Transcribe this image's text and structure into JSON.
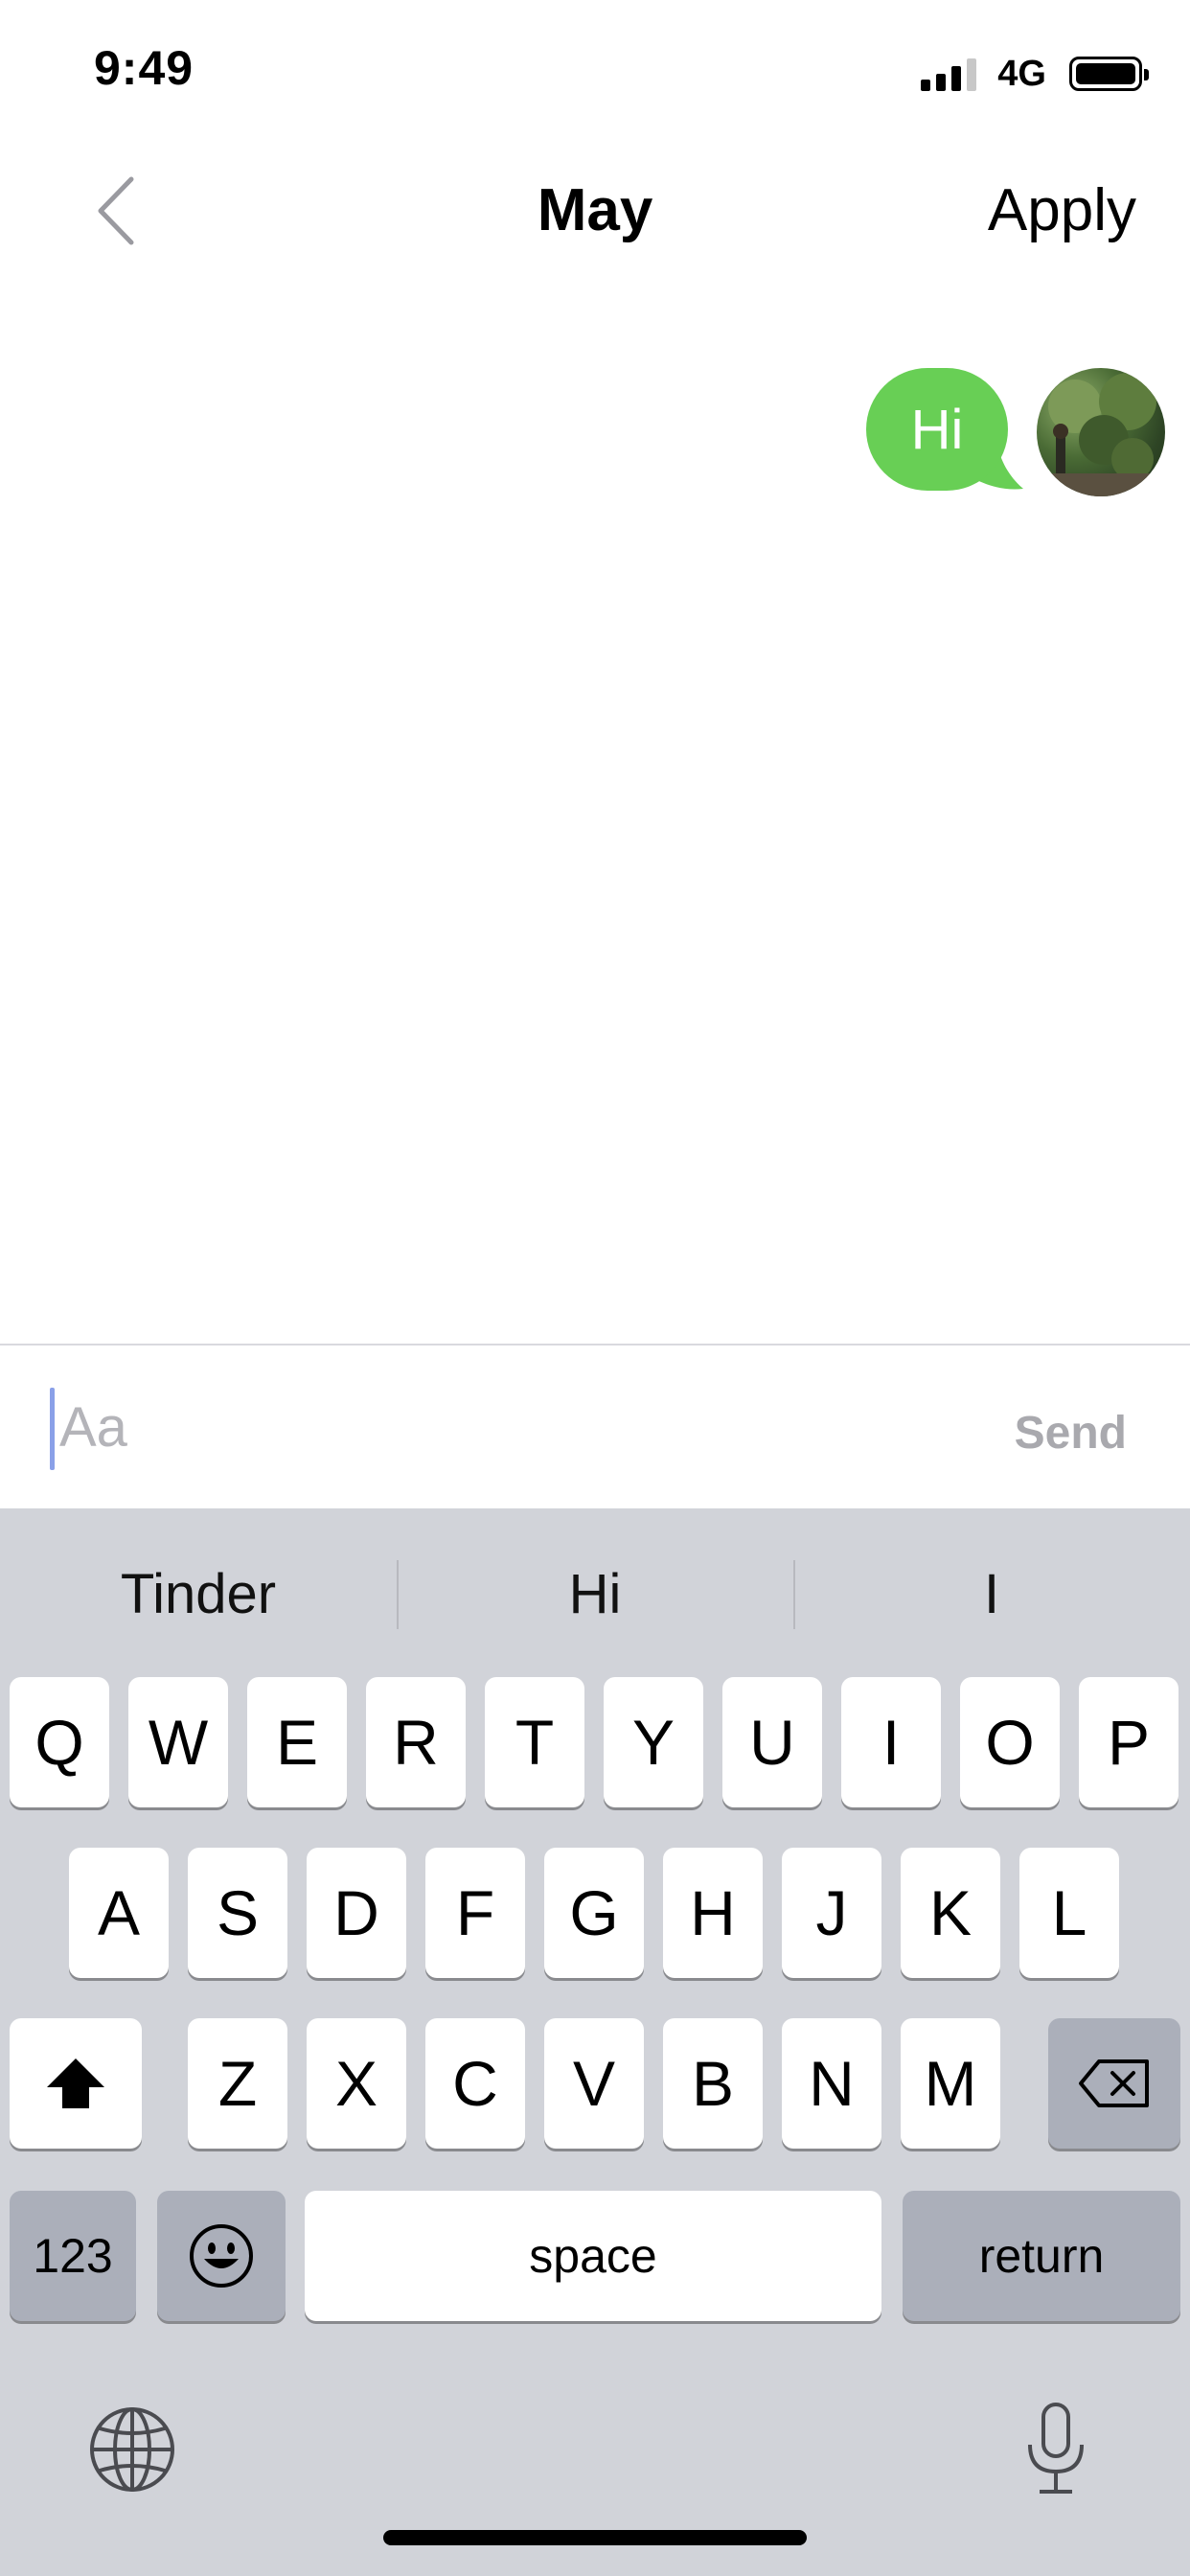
{
  "status": {
    "time": "9:49",
    "network": "4G"
  },
  "nav": {
    "title": "May",
    "apply_label": "Apply"
  },
  "messages": [
    {
      "text": "Hi"
    }
  ],
  "input": {
    "placeholder": "Aa",
    "value": "",
    "send_label": "Send"
  },
  "keyboard": {
    "suggestions": [
      "Tinder",
      "Hi",
      "I"
    ],
    "row1": [
      "Q",
      "W",
      "E",
      "R",
      "T",
      "Y",
      "U",
      "I",
      "O",
      "P"
    ],
    "row2": [
      "A",
      "S",
      "D",
      "F",
      "G",
      "H",
      "J",
      "K",
      "L"
    ],
    "row3": [
      "Z",
      "X",
      "C",
      "V",
      "B",
      "N",
      "M"
    ],
    "numbers_label": "123",
    "space_label": "space",
    "return_label": "return"
  },
  "icons": {
    "back": "chevron-left-icon",
    "shift": "shift-icon",
    "delete": "backspace-icon",
    "emoji": "emoji-icon",
    "globe": "globe-icon",
    "mic": "microphone-icon"
  },
  "colors": {
    "bubble": "#68cf55",
    "send_disabled": "#a9a9ae",
    "keyboard_bg": "#d1d3d9"
  }
}
